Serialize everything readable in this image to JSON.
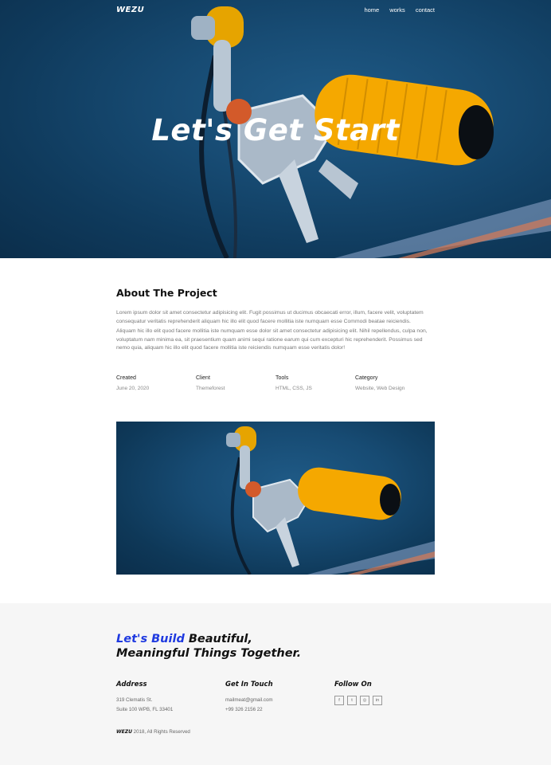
{
  "nav": {
    "brand": "WEZU",
    "links": [
      "home",
      "works",
      "contact"
    ]
  },
  "hero": {
    "title": "Let's Get Start"
  },
  "about": {
    "heading": "About The Project",
    "paragraphs": [
      "Lorem ipsum dolor sit amet consectetur adipisicing elit. Fugit possimus ut ducimus obcaecati error, illum, facere velit, voluptatem consequatur veritatis reprehenderit aliquam hic illo elit quod facere mollitia iste numquam esse Commodi beatae reiciendis.",
      "Aliquam hic illo elit quod facere mollitia iste numquam esse dolor sit amet consectetur adipisicing elit. Nihil repellendus, culpa non, voluptatum nam minima ea, sit praesentium quam animi sequi ratione earum qui cum excepturi hic reprehenderit. Possimus sed nemo quia, aliquam hic illo elit quod facere mollitia iste reiciendis numquam esse veritatis dolor!"
    ]
  },
  "meta": [
    {
      "label": "Created",
      "value": "June 20, 2020"
    },
    {
      "label": "Client",
      "value": "Themeforest"
    },
    {
      "label": "Tools",
      "value": "HTML, CSS, JS"
    },
    {
      "label": "Category",
      "value": "Website, Web Design"
    }
  ],
  "footer": {
    "cta_accent": "Let's Build",
    "cta_rest1": " Beautiful,",
    "cta_line2": "Meaningful Things Together.",
    "address": {
      "heading": "Address",
      "line1": "319 Clematis St.",
      "line2": "Suite 100 WPB, FL 33401"
    },
    "contact": {
      "heading": "Get In Touch",
      "email": "mailmeat@gmail.com",
      "phone": "+99 326 2156 22"
    },
    "follow": {
      "heading": "Follow On",
      "icons": [
        "facebook-icon",
        "twitter-icon",
        "instagram-icon",
        "linkedin-icon"
      ],
      "glyphs": [
        "f",
        "t",
        "◎",
        "in"
      ]
    },
    "copyright_brand": "WEZU",
    "copyright_text": " 2018, All Rights Reserved"
  },
  "colors": {
    "accent": "#1f3ae0",
    "grip": "#f5a300",
    "hero_bg": "#174b73"
  }
}
